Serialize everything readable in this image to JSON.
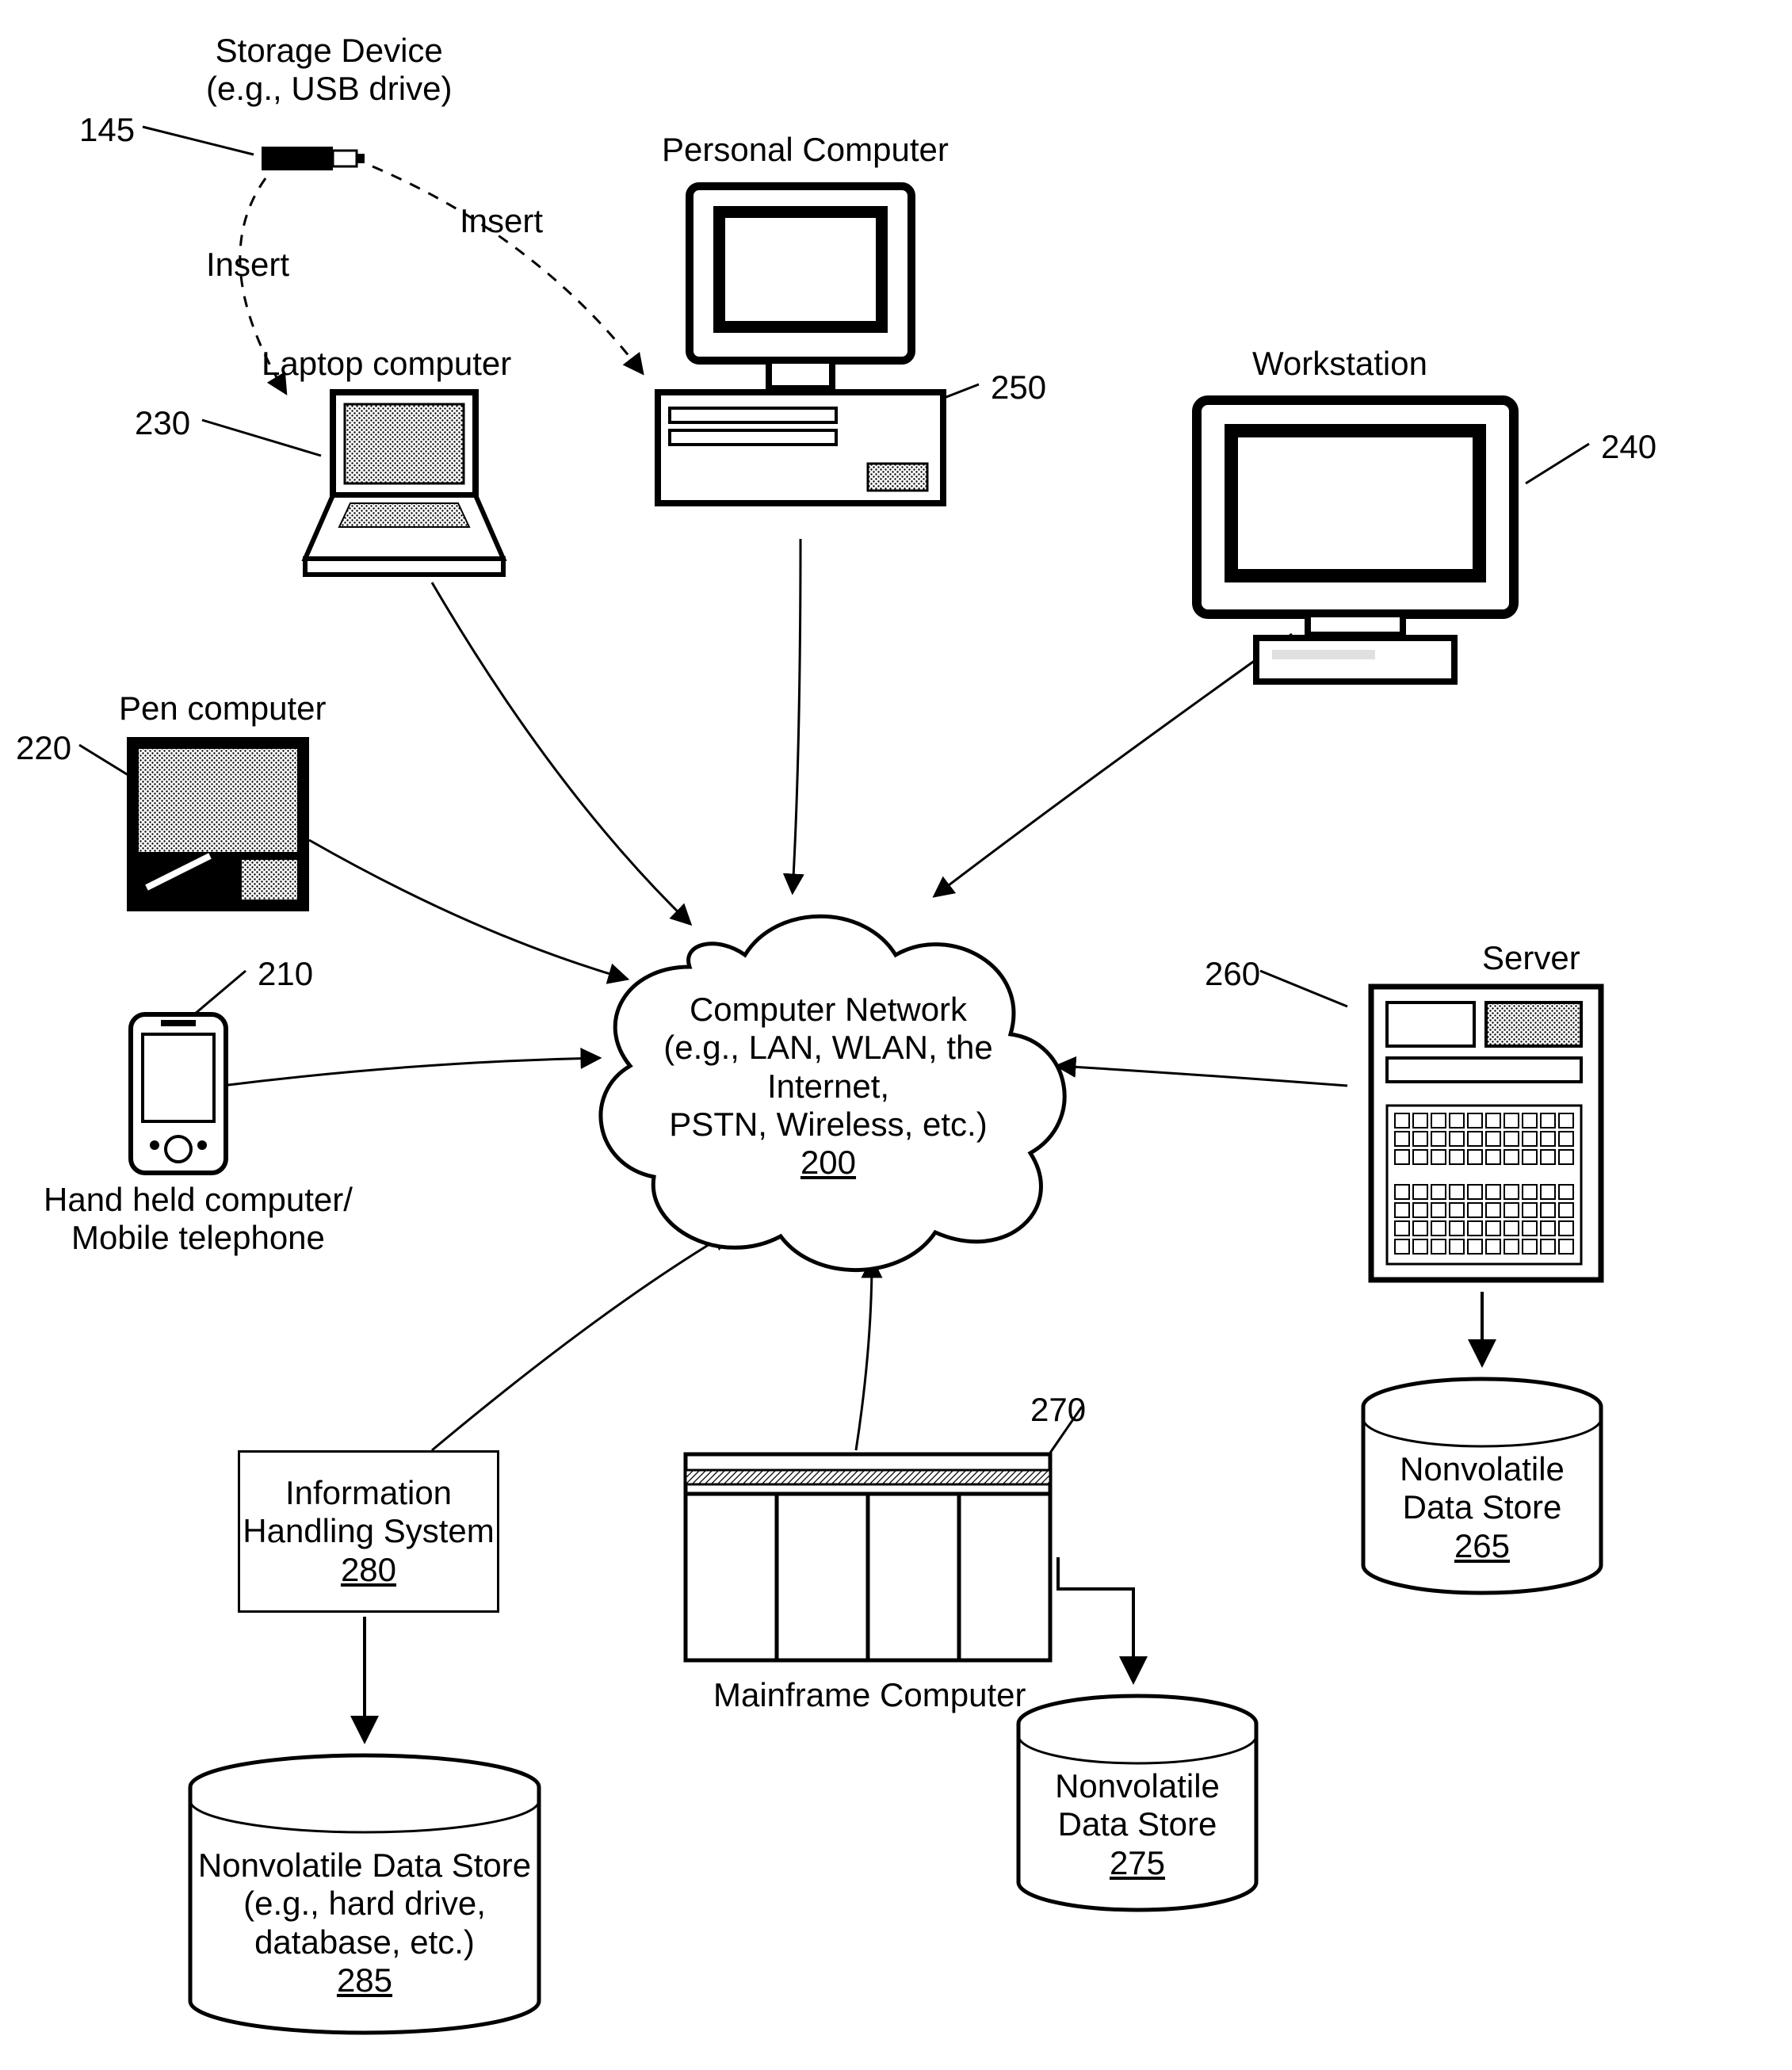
{
  "storage": {
    "label": "Storage Device\n(e.g., USB drive)",
    "ref": "145",
    "insert1": "Insert",
    "insert2": "Insert"
  },
  "laptop": {
    "label": "Laptop computer",
    "ref": "230"
  },
  "pc": {
    "label": "Personal Computer",
    "ref": "250"
  },
  "workstation": {
    "label": "Workstation",
    "ref": "240"
  },
  "pen": {
    "label": "Pen computer",
    "ref": "220"
  },
  "handheld": {
    "label": "Hand held computer/\nMobile telephone",
    "ref": "210"
  },
  "server": {
    "label": "Server",
    "ref": "260"
  },
  "mainframe": {
    "label": "Mainframe Computer",
    "ref": "270"
  },
  "ihs": {
    "line1": "Information",
    "line2": "Handling System",
    "ref": "280"
  },
  "ds_server": {
    "line1": "Nonvolatile",
    "line2": "Data Store",
    "ref": "265"
  },
  "ds_mainframe": {
    "line1": "Nonvolatile",
    "line2": "Data Store",
    "ref": "275"
  },
  "ds_ihs": {
    "line1": "Nonvolatile Data Store",
    "line2": "(e.g., hard drive,",
    "line3": "database, etc.)",
    "ref": "285"
  },
  "cloud": {
    "line1": "Computer Network",
    "line2": "(e.g., LAN, WLAN, the Internet,",
    "line3": "PSTN, Wireless, etc.)",
    "ref": "200"
  }
}
